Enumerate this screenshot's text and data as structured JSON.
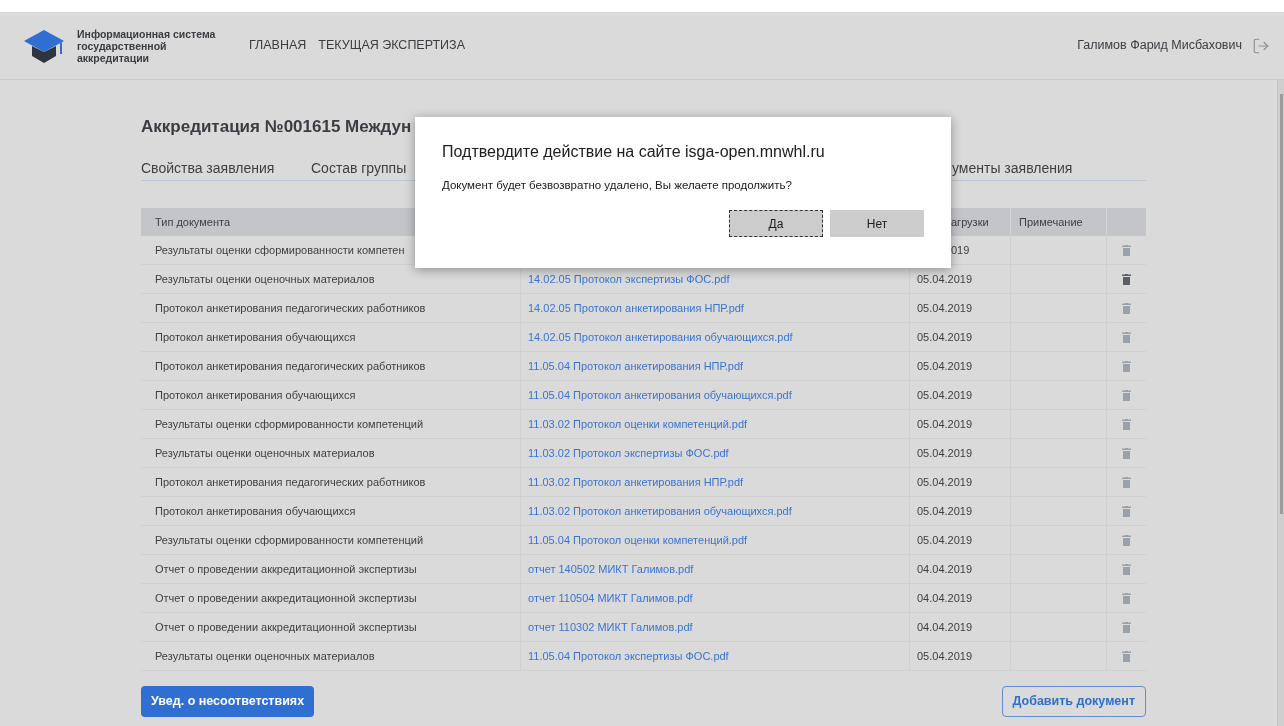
{
  "header": {
    "logo_text": "Информационная система государственной аккредитации",
    "nav": [
      {
        "label": "ГЛАВНАЯ"
      },
      {
        "label": "ТЕКУЩАЯ ЭКСПЕРТИЗА"
      }
    ],
    "user": "Галимов Фарид Мисбахович"
  },
  "title": "Аккредитация №001615 Междун",
  "tabs": [
    {
      "label": "Свойства заявления"
    },
    {
      "label": "Состав группы"
    },
    {
      "label": "ументы заявления"
    }
  ],
  "table": {
    "columns": [
      "Тип документа",
      "",
      "агрузки",
      "Примечание",
      ""
    ],
    "rows": [
      {
        "type": "Результаты оценки сформированности компетен",
        "file": "",
        "date": "019",
        "hovered": false
      },
      {
        "type": "Результаты оценки оценочных материалов",
        "file": "14.02.05 Протокол экспертизы ФОС.pdf",
        "date": "05.04.2019",
        "hovered": true
      },
      {
        "type": "Протокол анкетирования педагогических работников",
        "file": "14.02.05 Протокол анкетирования НПР.pdf",
        "date": "05.04.2019",
        "hovered": false
      },
      {
        "type": "Протокол анкетирования обучающихся",
        "file": "14.02.05 Протокол анкетирования обучающихся.pdf",
        "date": "05.04.2019",
        "hovered": false
      },
      {
        "type": "Протокол анкетирования педагогических работников",
        "file": "11.05.04 Протокол анкетирования НПР.pdf",
        "date": "05.04.2019",
        "hovered": false
      },
      {
        "type": "Протокол анкетирования обучающихся",
        "file": "11.05.04 Протокол анкетирования обучающихся.pdf",
        "date": "05.04.2019",
        "hovered": false
      },
      {
        "type": "Результаты оценки сформированности компетенций",
        "file": "11.03.02 Протокол оценки компетенций.pdf",
        "date": "05.04.2019",
        "hovered": false
      },
      {
        "type": "Результаты оценки оценочных материалов",
        "file": "11.03.02 Протокол экспертизы ФОС.pdf",
        "date": "05.04.2019",
        "hovered": false
      },
      {
        "type": "Протокол анкетирования педагогических работников",
        "file": "11.03.02 Протокол анкетирования НПР.pdf",
        "date": "05.04.2019",
        "hovered": false
      },
      {
        "type": "Протокол анкетирования обучающихся",
        "file": "11.03.02 Протокол анкетирования обучающихся.pdf",
        "date": "05.04.2019",
        "hovered": false
      },
      {
        "type": "Результаты оценки сформированности компетенций",
        "file": "11.05.04 Протокол оценки компетенций.pdf",
        "date": "05.04.2019",
        "hovered": false
      },
      {
        "type": "Отчет о проведении аккредитационной экспертизы",
        "file": "отчет 140502 МИКТ Галимов.pdf",
        "date": "04.04.2019",
        "hovered": false
      },
      {
        "type": "Отчет о проведении аккредитационной экспертизы",
        "file": "отчет 110504 МИКТ Галимов.pdf",
        "date": "04.04.2019",
        "hovered": false
      },
      {
        "type": "Отчет о проведении аккредитационной экспертизы",
        "file": "отчет 110302 МИКТ Галимов.pdf",
        "date": "04.04.2019",
        "hovered": false
      },
      {
        "type": "Результаты оценки оценочных материалов",
        "file": "11.05.04 Протокол экспертизы ФОС.pdf",
        "date": "05.04.2019",
        "hovered": false
      }
    ]
  },
  "footer": {
    "notify_button": "Увед. о несоответствиях",
    "add_button": "Добавить документ"
  },
  "dialog": {
    "title": "Подтвердите действие на сайте isga-open.mnwhl.ru",
    "message": "Документ будет безвозвратно удалено, Вы желаете продолжить?",
    "buttons": [
      {
        "label": "Да",
        "selected": true
      },
      {
        "label": "Нет",
        "selected": false
      }
    ]
  }
}
